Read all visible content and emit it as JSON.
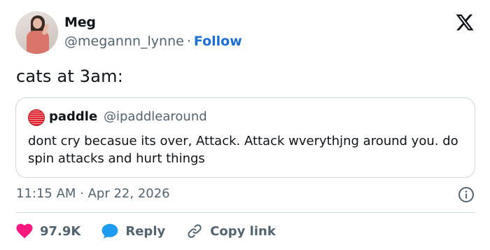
{
  "author": {
    "name": "Meg",
    "handle": "@megannn_lynne",
    "separator": "·",
    "follow_label": "Follow"
  },
  "tweet": {
    "text": "cats at 3am:",
    "timestamp": "11:15 AM · Apr 22, 2026"
  },
  "quoted_tweet": {
    "name": "paddle",
    "handle": "@ipaddlearound",
    "text": "dont cry becasue its over, Attack. Attack wverythjng around you. do spin attacks and hurt things"
  },
  "actions": {
    "like_count": "97.9K",
    "reply_label": "Reply",
    "copy_link_label": "Copy link"
  },
  "icons": {
    "logo": "x-logo-icon",
    "info": "info-icon",
    "like": "heart-icon",
    "reply": "reply-bubble-icon",
    "copy": "link-icon"
  },
  "colors": {
    "follow": "#1d6fd6",
    "like": "#f91880",
    "reply": "#1d9bf0",
    "secondary_text": "#536471"
  }
}
